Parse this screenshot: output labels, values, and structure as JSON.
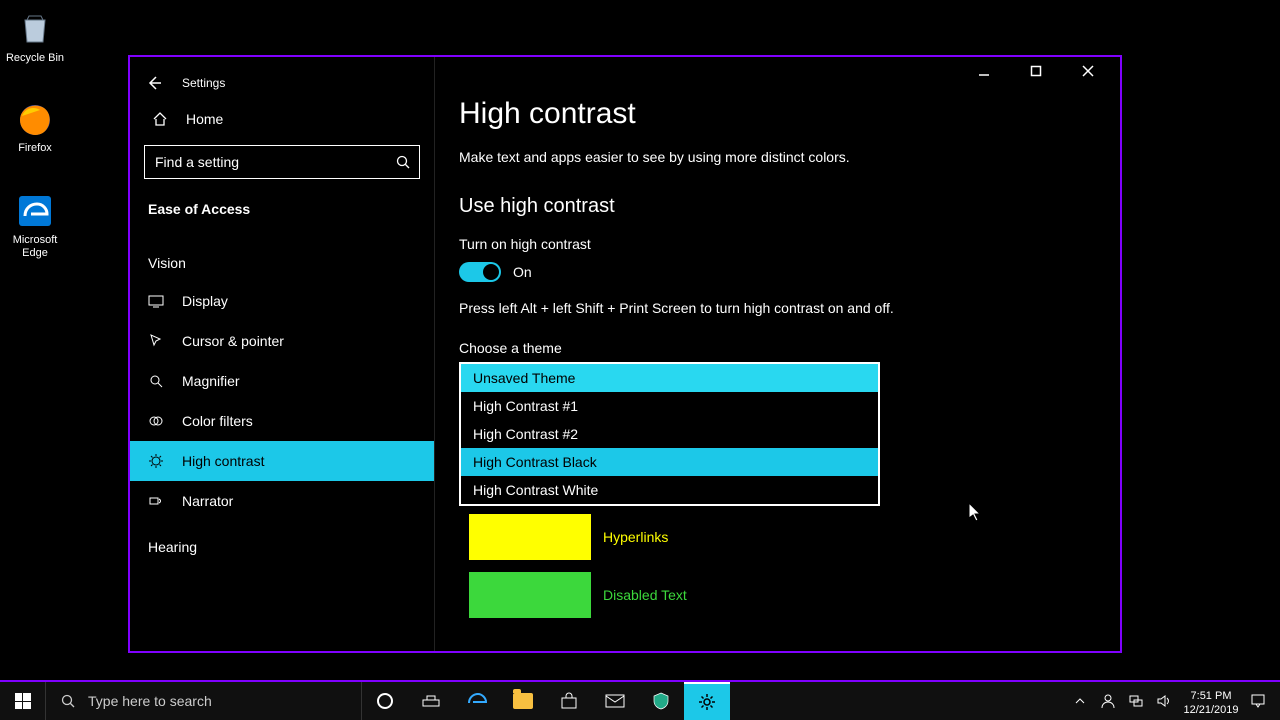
{
  "desktop": {
    "icons": [
      {
        "label": "Recycle Bin"
      },
      {
        "label": "Firefox"
      },
      {
        "label": "Microsoft Edge"
      }
    ]
  },
  "window": {
    "app_title": "Settings",
    "home_label": "Home",
    "search_placeholder": "Find a setting",
    "category_title": "Ease of Access",
    "groups": {
      "vision_title": "Vision",
      "hearing_title": "Hearing"
    },
    "nav": [
      {
        "label": "Display"
      },
      {
        "label": "Cursor & pointer"
      },
      {
        "label": "Magnifier"
      },
      {
        "label": "Color filters"
      },
      {
        "label": "High contrast"
      },
      {
        "label": "Narrator"
      }
    ]
  },
  "page": {
    "title": "High contrast",
    "description": "Make text and apps easier to see by using more distinct colors.",
    "section_title": "Use high contrast",
    "toggle_label": "Turn on high contrast",
    "toggle_state": "On",
    "shortcut_hint": "Press left Alt + left Shift + Print Screen to turn high contrast on and off.",
    "choose_label": "Choose a theme",
    "dropdown": {
      "options": [
        "Unsaved Theme",
        "High Contrast #1",
        "High Contrast #2",
        "High Contrast Black",
        "High Contrast White"
      ],
      "selected_index": 0,
      "hover_index": 3
    },
    "swatches": {
      "hyperlinks_label": "Hyperlinks",
      "disabled_label": "Disabled Text",
      "hyperlinks_color": "#ffff00",
      "disabled_color": "#3cd83c"
    }
  },
  "taskbar": {
    "search_placeholder": "Type here to search",
    "clock_time": "7:51 PM",
    "clock_date": "12/21/2019"
  },
  "colors": {
    "accent": "#1cc8e8",
    "border": "#8000ff"
  }
}
